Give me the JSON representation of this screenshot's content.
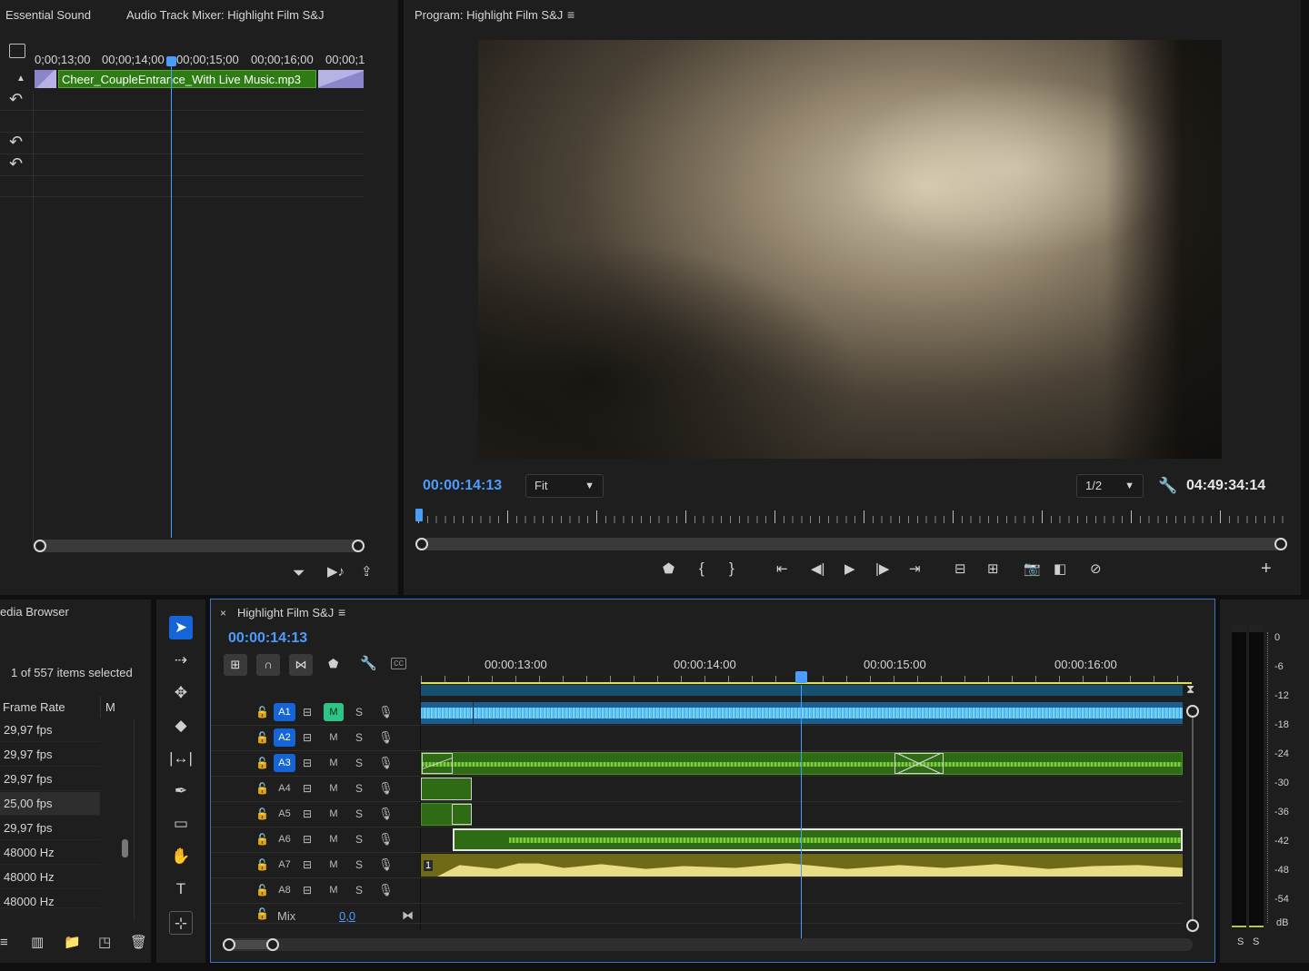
{
  "source_panel": {
    "tabs": [
      "Essential Sound",
      "Audio Track Mixer: Highlight Film S&J"
    ],
    "ruler_labels": [
      "0;00;13;00",
      "00;00;14;00",
      "00;00;15;00",
      "00;00;16;00",
      "00;00;1"
    ],
    "clip_name": "Cheer_CoupleEntrance_With Live Music.mp3"
  },
  "program_monitor": {
    "title": "Program: Highlight Film S&J",
    "timecode": "00:00:14:13",
    "zoom": "Fit",
    "resolution": "1/2",
    "duration": "04:49:34:14"
  },
  "media_browser": {
    "title": "edia Browser",
    "selection_info": "1 of 557 items selected",
    "columns": [
      "Frame Rate",
      "M"
    ],
    "rows": [
      "29,97 fps",
      "29,97 fps",
      "29,97 fps",
      "25,00 fps",
      "29,97 fps",
      "48000 Hz",
      "48000 Hz",
      "48000 Hz"
    ],
    "selected_index": 3
  },
  "timeline": {
    "title": "Highlight Film S&J",
    "timecode": "00:00:14:13",
    "ruler_labels": [
      "00:00:13:00",
      "00:00:14:00",
      "00:00:15:00",
      "00:00:16:00"
    ],
    "tracks": [
      {
        "name": "A1",
        "targeted": true,
        "mute_on": true
      },
      {
        "name": "A2",
        "targeted": true,
        "mute_on": false
      },
      {
        "name": "A3",
        "targeted": true,
        "mute_on": false
      },
      {
        "name": "A4",
        "targeted": false,
        "mute_on": false
      },
      {
        "name": "A5",
        "targeted": false,
        "mute_on": false
      },
      {
        "name": "A6",
        "targeted": false,
        "mute_on": false
      },
      {
        "name": "A7",
        "targeted": false,
        "mute_on": false
      },
      {
        "name": "A8",
        "targeted": false,
        "mute_on": false
      }
    ],
    "mute_label": "M",
    "solo_label": "S",
    "mix_label": "Mix",
    "mix_value": "0,0",
    "clip_a7_label": "1"
  },
  "audio_meter": {
    "scale": [
      "0",
      "-6",
      "-12",
      "-18",
      "-24",
      "-30",
      "-36",
      "-42",
      "-48",
      "-54",
      "dB"
    ],
    "solo_labels": [
      "S",
      "S"
    ]
  },
  "colors": {
    "accent_blue": "#4a9cff",
    "target_blue": "#1565d8",
    "clip_green": "#2f6a15",
    "clip_blue": "#1b5f8f",
    "clip_yellow": "#6e6a18",
    "mute_green": "#2fc384"
  }
}
